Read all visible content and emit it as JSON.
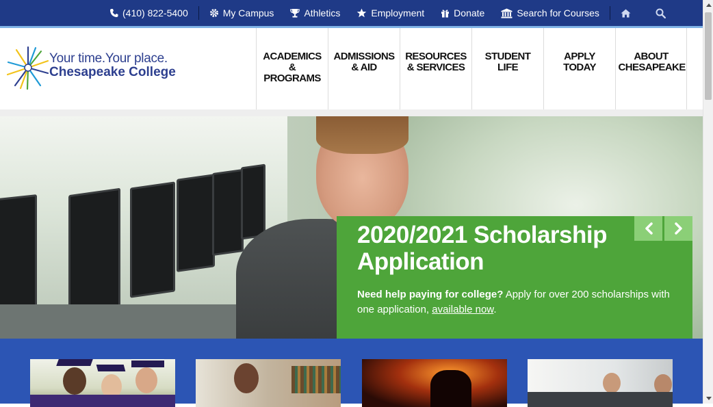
{
  "topbar": {
    "phone": "(410) 822-5400",
    "links": [
      "My Campus",
      "Athletics",
      "Employment",
      "Donate",
      "Search for Courses"
    ]
  },
  "logo": {
    "tagline": "Your time.Your place.",
    "name": "Chesapeake College"
  },
  "nav": {
    "items": [
      "ACADEMICS & PROGRAMS",
      "ADMISSIONS & AID",
      "RESOURCES & SERVICES",
      "STUDENT LIFE",
      "APPLY TODAY",
      "ABOUT CHESAPEAKE"
    ]
  },
  "hero": {
    "title": "2020/2021 Scholarship Application",
    "lead": "Need help paying for college?",
    "body": " Apply for over 200 scholarships with one application, ",
    "link": "available now",
    "end": "."
  },
  "colors": {
    "topbar": "#1f3a87",
    "caption": "#4ea53a",
    "band": "#2c55b4"
  },
  "icons": [
    "phone-icon",
    "gear-icon",
    "trophy-icon",
    "star-icon",
    "gift-icon",
    "institution-icon",
    "home-icon",
    "search-icon",
    "chevron-left-icon",
    "chevron-right-icon"
  ]
}
